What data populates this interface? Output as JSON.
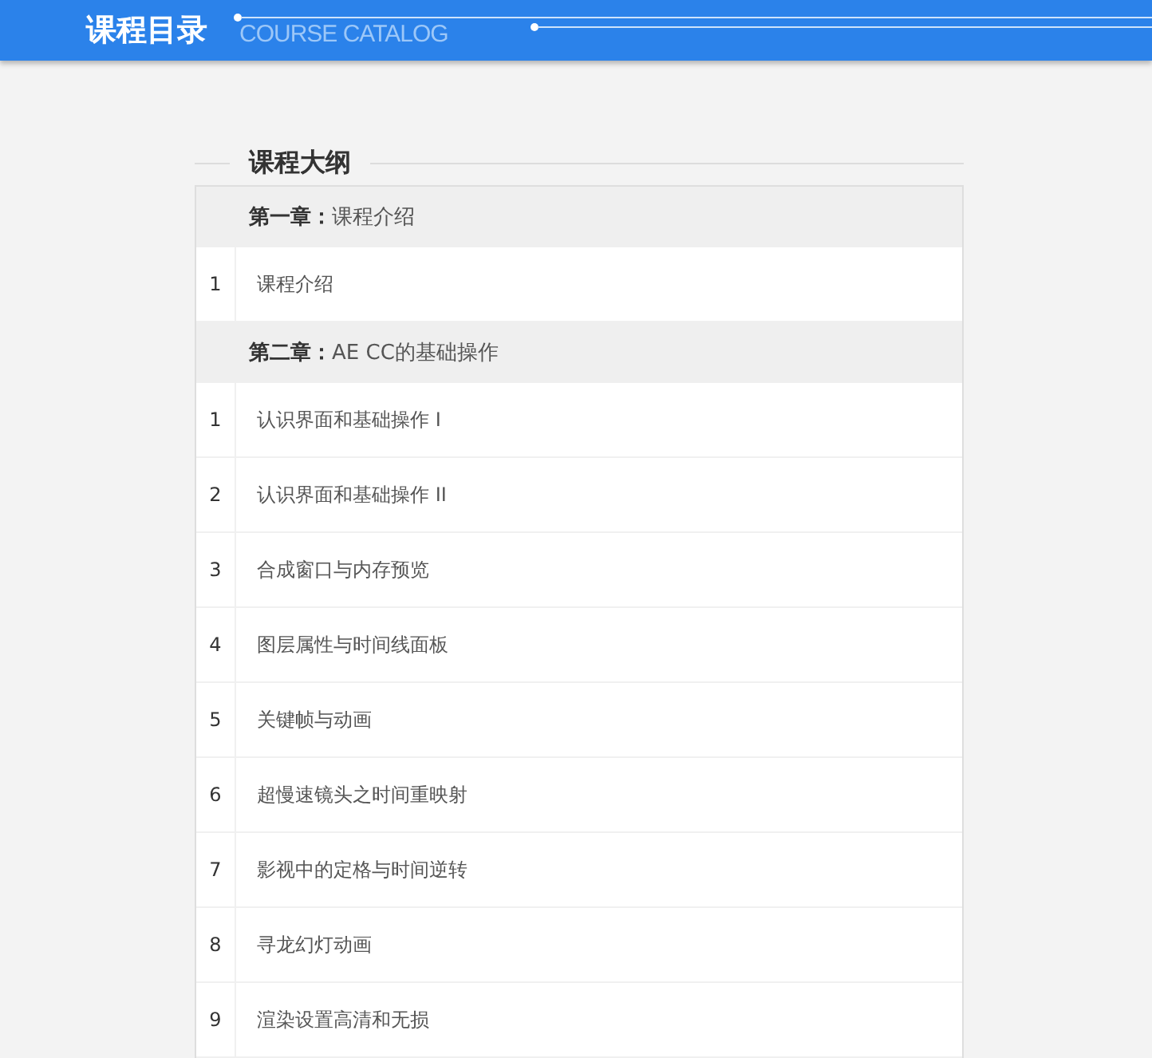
{
  "header": {
    "title": "课程目录",
    "subtitle": "COURSE CATALOG"
  },
  "section": {
    "title": "课程大纲"
  },
  "chapters": [
    {
      "heading": "**第一章：**课程介绍",
      "lessons": [
        {
          "number": "1",
          "title": "课程介绍"
        }
      ]
    },
    {
      "heading": "**第二章：**AE CC的基础操作",
      "lessons": [
        {
          "number": "1",
          "title": "认识界面和基础操作 I"
        },
        {
          "number": "2",
          "title": "认识界面和基础操作 II"
        },
        {
          "number": "3",
          "title": "合成窗口与内存预览"
        },
        {
          "number": "4",
          "title": "图层属性与时间线面板"
        },
        {
          "number": "5",
          "title": "关键帧与动画"
        },
        {
          "number": "6",
          "title": "超慢速镜头之时间重映射"
        },
        {
          "number": "7",
          "title": "影视中的定格与时间逆转"
        },
        {
          "number": "8",
          "title": "寻龙幻灯动画"
        },
        {
          "number": "9",
          "title": "渲染设置高清和无损"
        }
      ]
    }
  ]
}
